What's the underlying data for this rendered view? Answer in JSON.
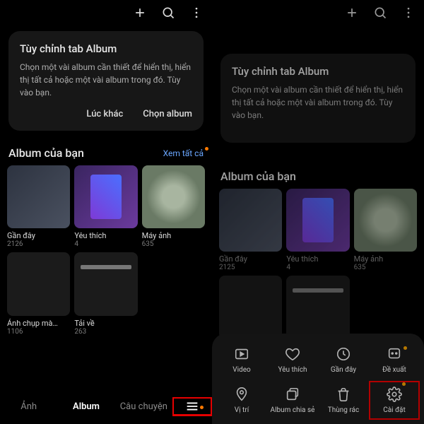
{
  "left": {
    "card": {
      "title": "Tùy chỉnh tab Album",
      "body": "Chọn một vài album cần thiết để hiển thị, hiển thị tất cả hoặc một vài album trong đó. Tùy vào bạn.",
      "later": "Lúc khác",
      "choose": "Chọn album"
    },
    "section": "Album của bạn",
    "viewAll": "Xem tất cả",
    "albums": [
      {
        "name": "Gần đây",
        "count": "2126"
      },
      {
        "name": "Yêu thích",
        "count": "4"
      },
      {
        "name": "Máy ảnh",
        "count": "635"
      },
      {
        "name": "Ảnh chụp mà…",
        "count": "1106"
      },
      {
        "name": "Tải về",
        "count": "263"
      }
    ],
    "tabs": {
      "photos": "Ảnh",
      "albums": "Album",
      "stories": "Câu chuyện"
    }
  },
  "right": {
    "card": {
      "title": "Tùy chỉnh tab Album",
      "body": "Chọn một vài album cần thiết để hiển thị, hiển thị tất cả hoặc một vài album trong đó. Tùy vào bạn."
    },
    "section": "Album của bạn",
    "albums": [
      {
        "name": "Gần đây",
        "count": "2125"
      },
      {
        "name": "Yêu thích",
        "count": "4"
      },
      {
        "name": "Máy ảnh",
        "count": "635"
      }
    ],
    "sheet": [
      {
        "label": "Video"
      },
      {
        "label": "Yêu thích"
      },
      {
        "label": "Gần đây"
      },
      {
        "label": "Đề xuất"
      },
      {
        "label": "Vị trí"
      },
      {
        "label": "Album chia sẻ"
      },
      {
        "label": "Thùng rác"
      },
      {
        "label": "Cài đặt"
      }
    ]
  }
}
